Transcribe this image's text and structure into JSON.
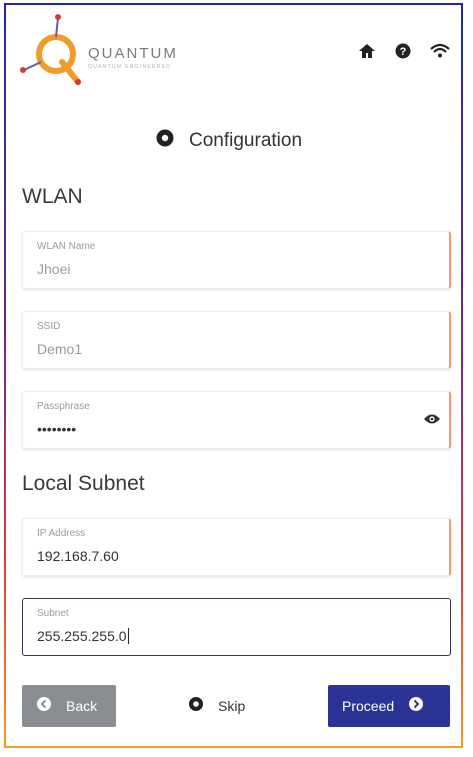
{
  "header": {
    "logo_text": "QUANTUM",
    "logo_subtitle": "QUANTUM ENGINEERED",
    "icons": [
      "home-icon",
      "help-icon",
      "wifi-icon"
    ]
  },
  "page": {
    "title": "Configuration",
    "title_icon": "gear-icon"
  },
  "wlan": {
    "heading": "WLAN",
    "name": {
      "label": "WLAN Name",
      "value": "Jhoei"
    },
    "ssid": {
      "label": "SSID",
      "value": "Demo1"
    },
    "passphrase": {
      "label": "Passphrase",
      "value": "••••••••"
    }
  },
  "subnet": {
    "heading": "Local Subnet",
    "ip": {
      "label": "IP Address",
      "value": "192.168.7.60"
    },
    "mask": {
      "label": "Subnet",
      "value": "255.255.255.0"
    }
  },
  "actions": {
    "back": "Back",
    "skip": "Skip",
    "proceed": "Proceed"
  },
  "colors": {
    "primary": "#2b3496",
    "secondary": "#8a8e93",
    "accent": "#f08a2a"
  }
}
